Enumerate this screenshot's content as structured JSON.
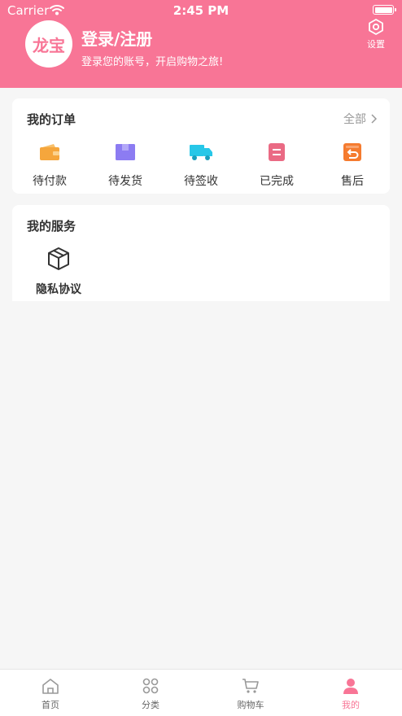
{
  "status_bar": {
    "carrier": "Carrier",
    "time": "2:45 PM"
  },
  "header": {
    "avatar_text": "龙宝",
    "login_title": "登录/注册",
    "login_subtitle": "登录您的账号，开启购物之旅!",
    "settings_label": "设置"
  },
  "orders": {
    "title": "我的订单",
    "all_label": "全部",
    "items": [
      {
        "label": "待付款",
        "icon": "wallet-icon",
        "color": "#f5a63c"
      },
      {
        "label": "待发货",
        "icon": "package-icon",
        "color": "#8c7cf2"
      },
      {
        "label": "待签收",
        "icon": "truck-icon",
        "color": "#27c7e8"
      },
      {
        "label": "已完成",
        "icon": "done-icon",
        "color": "#ea6a84"
      },
      {
        "label": "售后",
        "icon": "return-icon",
        "color": "#f57b2f"
      }
    ]
  },
  "services": {
    "title": "我的服务",
    "items": [
      {
        "label": "隐私协议",
        "icon": "box-icon"
      }
    ]
  },
  "tabbar": {
    "items": [
      {
        "label": "首页",
        "icon": "home-icon"
      },
      {
        "label": "分类",
        "icon": "category-icon"
      },
      {
        "label": "购物车",
        "icon": "cart-icon"
      },
      {
        "label": "我的",
        "icon": "user-icon",
        "active": true
      }
    ]
  },
  "colors": {
    "brand": "#f87596",
    "background": "#f6f6f6"
  }
}
